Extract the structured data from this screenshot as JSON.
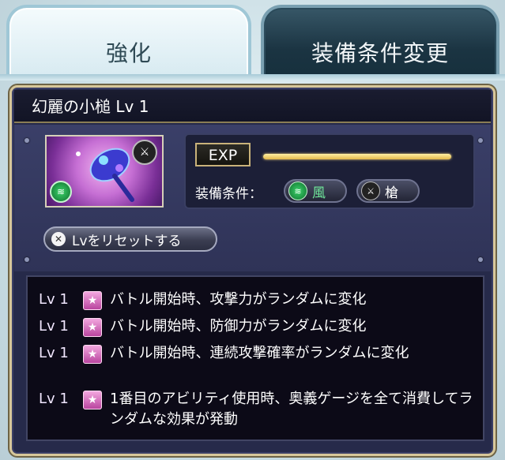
{
  "tabs": [
    {
      "label": "強化",
      "active": true
    },
    {
      "label": "装備条件変更",
      "active": false
    }
  ],
  "item": {
    "title": "幻麗の小槌 Lv 1"
  },
  "exp": {
    "label": "EXP",
    "progress": 1.0
  },
  "conditions": {
    "label": "装備条件：",
    "element": "風",
    "weapon": "槍"
  },
  "reset": {
    "label": "Lvをリセットする"
  },
  "skills": [
    {
      "lv": "Lv 1",
      "text": "バトル開始時、攻撃力がランダムに変化"
    },
    {
      "lv": "Lv 1",
      "text": "バトル開始時、防御力がランダムに変化"
    },
    {
      "lv": "Lv 1",
      "text": "バトル開始時、連続攻撃確率がランダムに変化"
    },
    {
      "lv": "Lv 1",
      "text": "1番目のアビリティ使用時、奥義ゲージを全て消費してランダムな効果が発動"
    }
  ],
  "colors": {
    "panel": "#262a4a",
    "gold": "#d7c79a",
    "wind": "#3bd36a",
    "star": "#f3a8df"
  }
}
